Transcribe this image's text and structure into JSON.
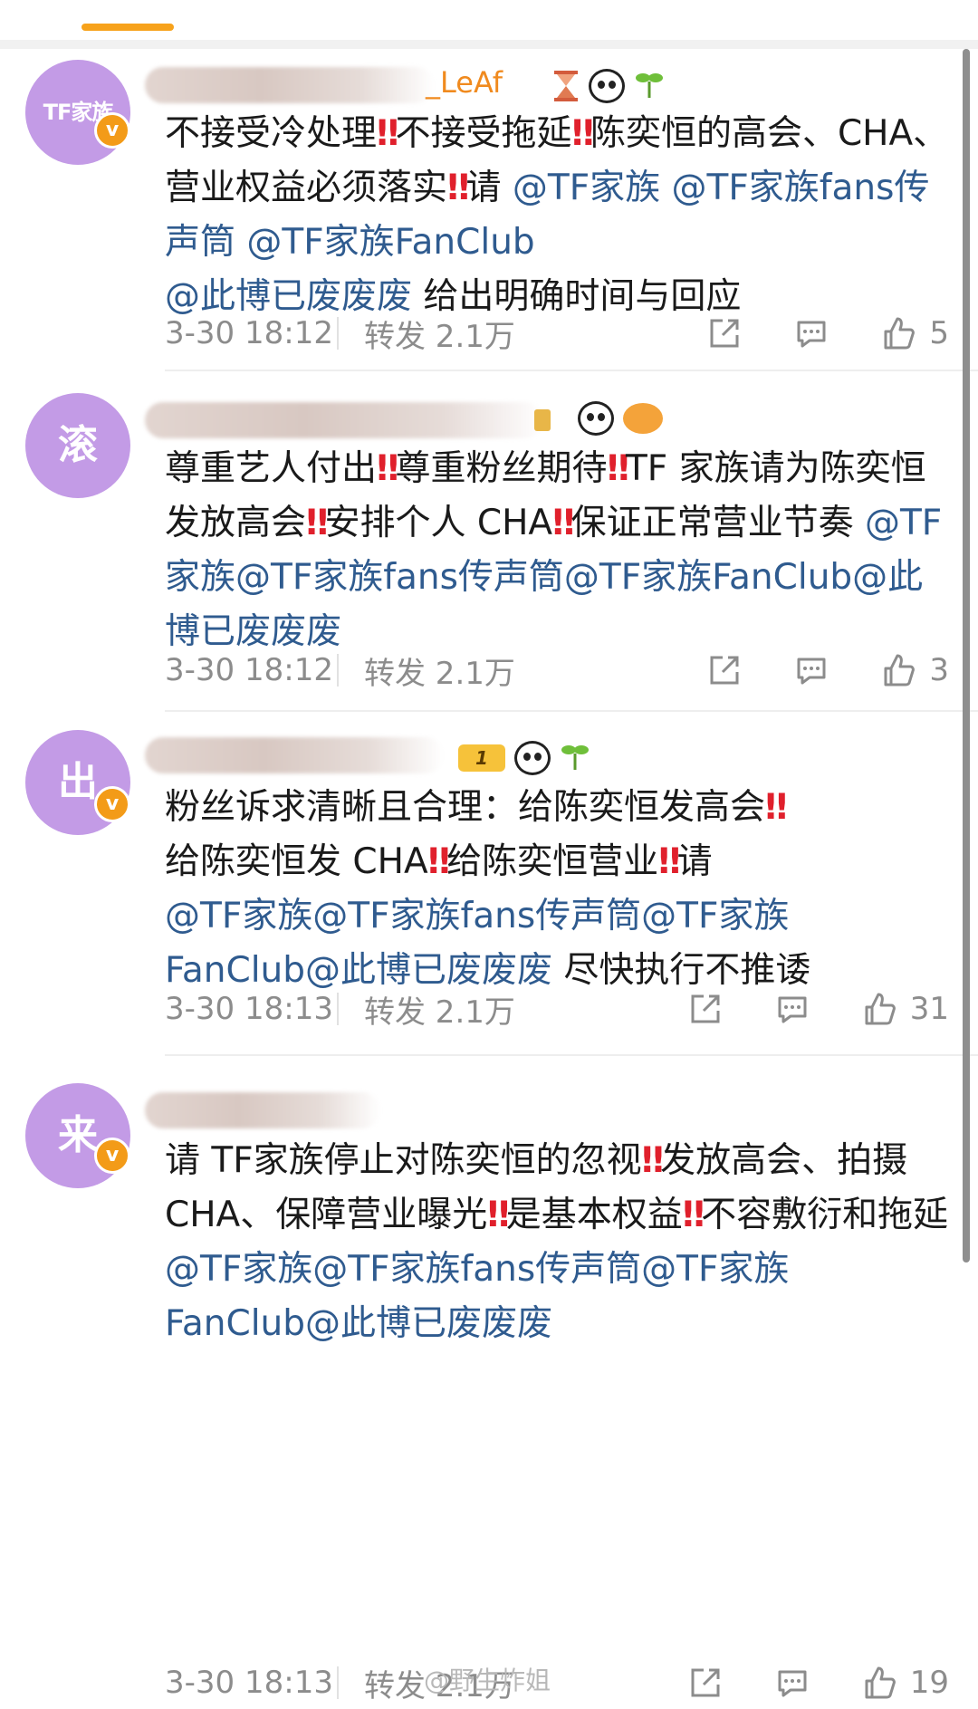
{
  "comments": [
    {
      "avatar_text": "TF家族",
      "visible_name": "_LeAf",
      "body_parts": [
        {
          "t": "不接受冷处理",
          "k": "text"
        },
        {
          "t": "‼",
          "k": "excl"
        },
        {
          "t": "不接受拖延",
          "k": "text"
        },
        {
          "t": "‼",
          "k": "excl"
        },
        {
          "t": "陈奕恒的高会、CHA、营业权益必须落实",
          "k": "text"
        },
        {
          "t": "‼",
          "k": "excl"
        },
        {
          "t": "请 ",
          "k": "text"
        },
        {
          "t": "@TF家族",
          "k": "mention"
        },
        {
          "t": " ",
          "k": "text"
        },
        {
          "t": "@TF家族fans传声筒",
          "k": "mention"
        },
        {
          "t": " ",
          "k": "text"
        },
        {
          "t": "@TF家族FanClub",
          "k": "mention"
        },
        {
          "t": "\n",
          "k": "text"
        },
        {
          "t": "@此博已废废废",
          "k": "mention"
        },
        {
          "t": " 给出明确时间与回应",
          "k": "text"
        }
      ],
      "time": "3-30 18:12",
      "repost": "转发 2.1万",
      "likes": "5"
    },
    {
      "avatar_text": "滚",
      "visible_name": "",
      "body_parts": [
        {
          "t": "尊重艺人付出",
          "k": "text"
        },
        {
          "t": "‼",
          "k": "excl"
        },
        {
          "t": "尊重粉丝期待",
          "k": "text"
        },
        {
          "t": "‼",
          "k": "excl"
        },
        {
          "t": "TF 家族请为陈奕恒发放高会",
          "k": "text"
        },
        {
          "t": "‼",
          "k": "excl"
        },
        {
          "t": "安排个人 CHA",
          "k": "text"
        },
        {
          "t": "‼",
          "k": "excl"
        },
        {
          "t": "保证正常营业节奏 ",
          "k": "text"
        },
        {
          "t": "@TF家族@TF家族fans传声筒@TF家族FanClub@此博已废废废",
          "k": "mention"
        }
      ],
      "time": "3-30 18:12",
      "repost": "转发 2.1万",
      "likes": "3"
    },
    {
      "avatar_text": "出",
      "visible_name": "",
      "body_parts": [
        {
          "t": "粉丝诉求清晰且合理：给陈奕恒发高会",
          "k": "text"
        },
        {
          "t": "‼",
          "k": "excl"
        },
        {
          "t": "\n给陈奕恒发 CHA",
          "k": "text"
        },
        {
          "t": "‼",
          "k": "excl"
        },
        {
          "t": "给陈奕恒营业",
          "k": "text"
        },
        {
          "t": "‼",
          "k": "excl"
        },
        {
          "t": "请\n",
          "k": "text"
        },
        {
          "t": "@TF家族@TF家族fans传声筒@TF家族FanClub@此博已废废废",
          "k": "mention"
        },
        {
          "t": " 尽快执行不推诿",
          "k": "text"
        }
      ],
      "time": "3-30 18:13",
      "repost": "转发 2.1万",
      "likes": "31"
    },
    {
      "avatar_text": "来",
      "visible_name": "",
      "body_parts": [
        {
          "t": "请 TF家族停止对陈奕恒的忽视",
          "k": "text"
        },
        {
          "t": "‼",
          "k": "excl"
        },
        {
          "t": "发放高会、拍摄 CHA、保障营业曝光",
          "k": "text"
        },
        {
          "t": "‼",
          "k": "excl"
        },
        {
          "t": "是基本权益",
          "k": "text"
        },
        {
          "t": "‼",
          "k": "excl"
        },
        {
          "t": "不容敷衍和拖延 ",
          "k": "text"
        },
        {
          "t": "@TF家族@TF家族fans传声筒@TF家族FanClub@此博已废废废",
          "k": "mention"
        }
      ],
      "time": "3-30 18:13",
      "repost": "转发 2.1万",
      "likes": "19"
    }
  ],
  "watermark": "@野生炸姐",
  "icons": {
    "share": "share-icon",
    "comment": "comment-icon",
    "like": "like-icon",
    "verified": "verified-icon",
    "panda": "panda-badge-icon",
    "sprout": "sprout-badge-icon",
    "hourglass": "hourglass-badge-icon",
    "fish": "fish-badge-icon",
    "level": "level-badge-icon"
  },
  "colors": {
    "accent": "#f7a21b",
    "mention": "#2f5b8f",
    "exclamation": "#e0202c",
    "avatar": "#c39be6",
    "meta": "#8c8c8c"
  }
}
